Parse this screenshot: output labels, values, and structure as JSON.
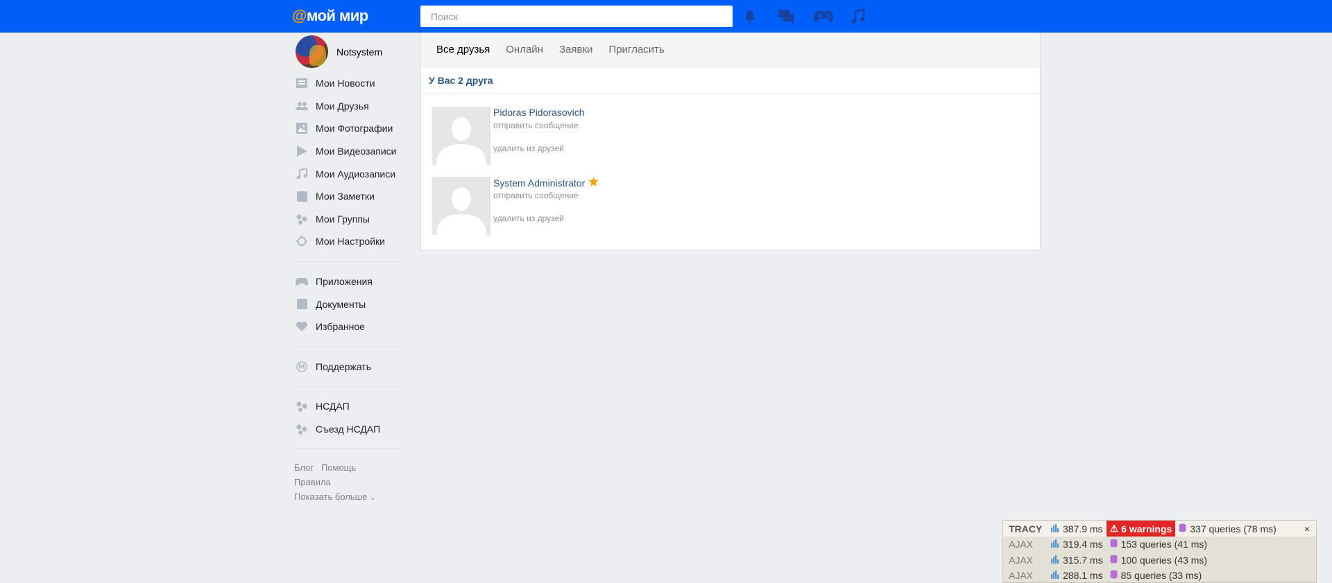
{
  "header": {
    "logo_at": "@",
    "logo_text": "мой мир",
    "search_placeholder": "Поиск",
    "icons": [
      "bell-icon",
      "messages-icon",
      "gamepad-icon",
      "music-icon"
    ]
  },
  "profile": {
    "name": "Notsystem"
  },
  "nav": {
    "main": [
      {
        "label": "Мои Новости",
        "icon": "news-icon"
      },
      {
        "label": "Мои Друзья",
        "icon": "friends-icon"
      },
      {
        "label": "Мои Фотографии",
        "icon": "photo-icon"
      },
      {
        "label": "Мои Видеозаписи",
        "icon": "video-icon"
      },
      {
        "label": "Мои Аудиозаписи",
        "icon": "audio-icon"
      },
      {
        "label": "Мои Заметки",
        "icon": "notes-icon"
      },
      {
        "label": "Мои Группы",
        "icon": "groups-icon"
      },
      {
        "label": "Мои Настройки",
        "icon": "settings-icon"
      }
    ],
    "extra": [
      {
        "label": "Приложения",
        "icon": "apps-icon"
      },
      {
        "label": "Документы",
        "icon": "documents-icon"
      },
      {
        "label": "Избранное",
        "icon": "heart-icon"
      }
    ],
    "support": [
      {
        "label": "Поддержать",
        "icon": "support-icon"
      }
    ],
    "groups": [
      {
        "label": "НСДАП",
        "icon": "group-icon"
      },
      {
        "label": "Съезд НСДАП",
        "icon": "group-icon"
      }
    ]
  },
  "footer": {
    "blog": "Блог",
    "help": "Помощь",
    "rules": "Правила",
    "more": "Показать больше"
  },
  "tabs": [
    "Все друзья",
    "Онлайн",
    "Заявки",
    "Пригласить"
  ],
  "friends_count_text": "У Вас 2 друга",
  "friends": [
    {
      "name": "Pidoras Pidorasovich",
      "send": "отправить сообщение",
      "remove": "удалить из друзей",
      "starred": false
    },
    {
      "name": "System Administrator",
      "send": "отправить сообщение",
      "remove": "удалить из друзей",
      "starred": true
    }
  ],
  "tracy": {
    "label": "TRACY",
    "time": "387.9 ms",
    "warnings": "6 warnings",
    "queries": "337 queries (78 ms)",
    "close": "×",
    "ajax": [
      {
        "label": "AJAX",
        "time": "319.4 ms",
        "queries": "153 queries (41 ms)"
      },
      {
        "label": "AJAX",
        "time": "315.7 ms",
        "queries": "100 queries (43 ms)"
      },
      {
        "label": "AJAX",
        "time": "288.1 ms",
        "queries": "85 queries (33 ms)"
      }
    ]
  },
  "colors": {
    "header_bg": "#005ff9",
    "logo_accent": "#ff9e00",
    "link": "#2a5885",
    "icon_gray": "#b2bac5",
    "warning_red": "#e22525",
    "star": "#f8a100"
  }
}
